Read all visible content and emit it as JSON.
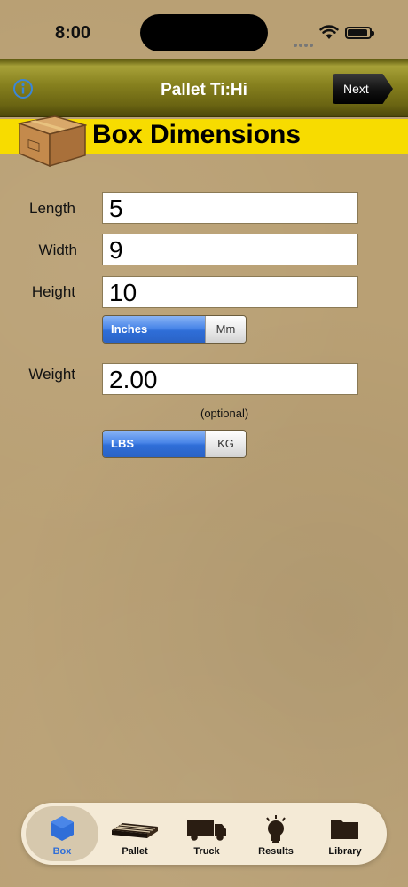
{
  "status_bar": {
    "time": "8:00"
  },
  "nav": {
    "title": "Pallet Ti:Hi",
    "next_label": "Next"
  },
  "section": {
    "title": "Box Dimensions"
  },
  "form": {
    "length": {
      "label": "Length",
      "value": "5"
    },
    "width": {
      "label": "Width",
      "value": "9"
    },
    "height": {
      "label": "Height",
      "value": "10"
    },
    "dimension_units": {
      "selected": "Inches",
      "other": "Mm"
    },
    "weight": {
      "label": "Weight",
      "value": "2.00"
    },
    "optional_note": "(optional)",
    "weight_units": {
      "selected": "LBS",
      "other": "KG"
    }
  },
  "tabs": [
    {
      "label": "Box",
      "icon": "cube-icon",
      "active": true
    },
    {
      "label": "Pallet",
      "icon": "pallet-icon",
      "active": false
    },
    {
      "label": "Truck",
      "icon": "truck-icon",
      "active": false
    },
    {
      "label": "Results",
      "icon": "lightbulb-icon",
      "active": false
    },
    {
      "label": "Library",
      "icon": "folder-icon",
      "active": false
    }
  ],
  "colors": {
    "nav_bar": "#86801e",
    "section_header": "#f7dc00",
    "segment_selected": "#2f6ed8",
    "background": "#b9a074"
  }
}
